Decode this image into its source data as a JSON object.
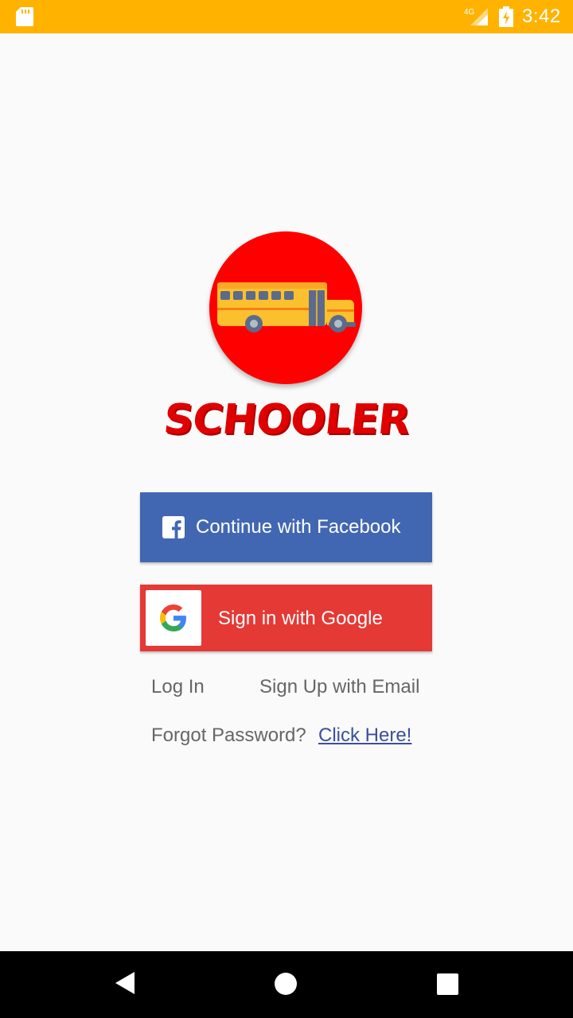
{
  "status_bar": {
    "time": "3:42",
    "network": "4G",
    "icons": [
      "sd-card-icon",
      "cell-signal-icon",
      "battery-charging-icon"
    ]
  },
  "app": {
    "title": "SCHOOLER",
    "logo_icon": "school-bus-icon",
    "colors": {
      "status_bar": "#ffb300",
      "logo_bg": "#ff0000",
      "title": "#e00000"
    }
  },
  "buttons": {
    "facebook_label": "Continue with Facebook",
    "facebook_color": "#4267b2",
    "google_label": "Sign in with Google",
    "google_color": "#e53935"
  },
  "links": {
    "login": "Log In",
    "signup": "Sign Up with Email",
    "forgot": "Forgot Password?",
    "click_here": "Click Here!"
  },
  "nav_bar": {
    "icons": [
      "back-icon",
      "home-icon",
      "recents-icon"
    ]
  }
}
